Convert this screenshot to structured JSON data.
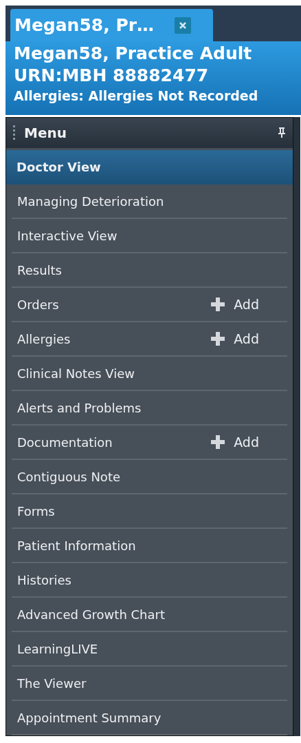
{
  "tab": {
    "label": "Megan58, Pr…",
    "selected": true
  },
  "banner": {
    "name": "Megan58, Practice Adult",
    "urn": "URN:MBH 88882477",
    "allergies": "Allergies: Allergies Not Recorded"
  },
  "menu": {
    "title": "Menu",
    "items": [
      {
        "label": "Doctor View",
        "selected": true
      },
      {
        "label": "Managing Deterioration",
        "selected": false
      },
      {
        "label": "Interactive View",
        "selected": false
      },
      {
        "label": "Results",
        "selected": false
      },
      {
        "label": "Orders",
        "selected": false,
        "action": "Add"
      },
      {
        "label": "Allergies",
        "selected": false,
        "action": "Add"
      },
      {
        "label": "Clinical Notes View",
        "selected": false
      },
      {
        "label": "Alerts and Problems",
        "selected": false
      },
      {
        "label": "Documentation",
        "selected": false,
        "action": "Add"
      },
      {
        "label": "Contiguous Note",
        "selected": false
      },
      {
        "label": "Forms",
        "selected": false
      },
      {
        "label": "Patient Information",
        "selected": false
      },
      {
        "label": "Histories",
        "selected": false
      },
      {
        "label": "Advanced Growth Chart",
        "selected": false
      },
      {
        "label": "LearningLIVE",
        "selected": false
      },
      {
        "label": "The Viewer",
        "selected": false
      },
      {
        "label": "Appointment Summary",
        "selected": false
      }
    ]
  }
}
